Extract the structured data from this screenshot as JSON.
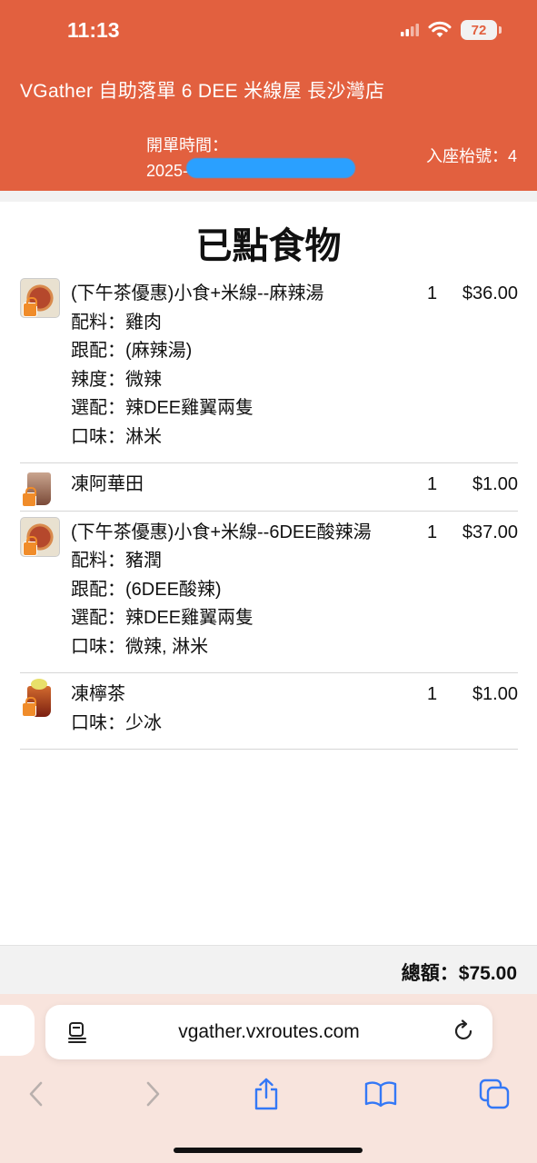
{
  "status_bar": {
    "time": "11:13",
    "battery": "72"
  },
  "header": {
    "shop_title": "VGather 自助落單 6 DEE 米線屋 長沙灣店",
    "open_time_label": "開單時間：",
    "open_time_value": "2025-",
    "table_label": "入座枱號：4"
  },
  "page_title": "已點食物",
  "orders": [
    {
      "lines": [
        "(下午茶優惠)小食+米線--麻辣湯",
        "配料：雞肉",
        "跟配：(麻辣湯)",
        "辣度：微辣",
        "選配：辣DEE雞翼兩隻",
        "口味：淋米"
      ],
      "qty": "1",
      "price": "$36.00",
      "icon": "noodle-bowl-icon"
    },
    {
      "lines": [
        "凍阿華田"
      ],
      "qty": "1",
      "price": "$1.00",
      "icon": "iced-drink-icon"
    },
    {
      "lines": [
        "(下午茶優惠)小食+米線--6DEE酸辣湯",
        "配料：豬潤",
        "跟配：(6DEE酸辣)",
        "選配：辣DEE雞翼兩隻",
        "口味：微辣, 淋米"
      ],
      "qty": "1",
      "price": "$37.00",
      "icon": "noodle-bowl-icon"
    },
    {
      "lines": [
        "凍檸茶",
        "口味：少冰"
      ],
      "qty": "1",
      "price": "$1.00",
      "icon": "iced-lemon-tea-icon"
    }
  ],
  "total": "總額：$75.00",
  "browser": {
    "url": "vgather.vxroutes.com"
  },
  "colors": {
    "header": "#E2603F",
    "browser_bar": "#F8E4DD",
    "ios_blue": "#3478F6"
  }
}
